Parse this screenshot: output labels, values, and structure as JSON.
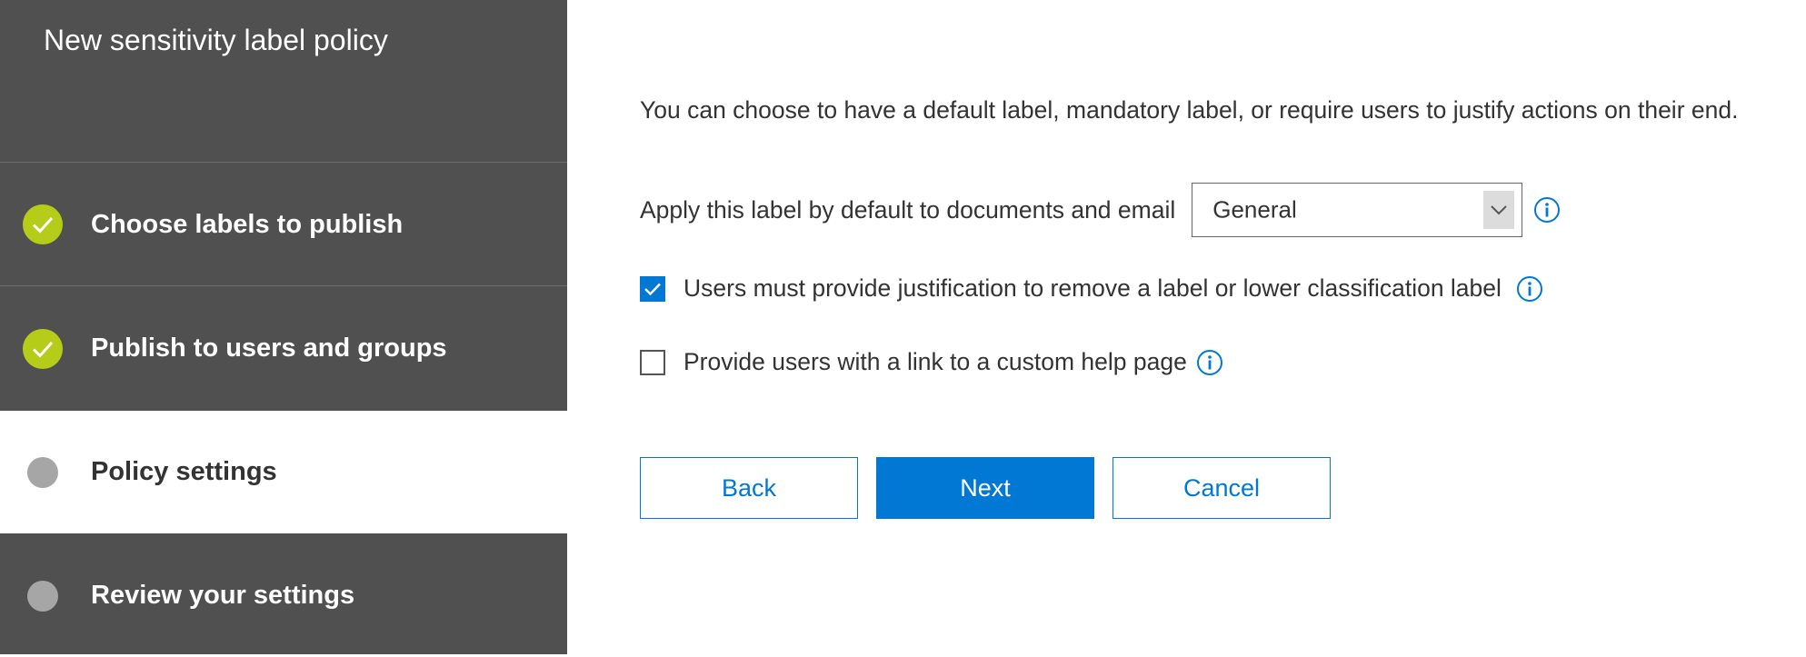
{
  "sidebar": {
    "title": "New sensitivity label policy",
    "steps": [
      {
        "label": "Choose labels to publish",
        "status": "completed"
      },
      {
        "label": "Publish to users and groups",
        "status": "completed"
      },
      {
        "label": "Policy settings",
        "status": "current"
      },
      {
        "label": "Review your settings",
        "status": "pending"
      }
    ]
  },
  "main": {
    "intro": "You can choose to have a default label, mandatory label, or require users to justify actions on their end.",
    "default_label": {
      "label": "Apply this label by default to documents and email",
      "selected": "General"
    },
    "options": [
      {
        "label": "Users must provide justification to remove a label or lower classification label",
        "checked": true
      },
      {
        "label": "Provide users with a link to a custom help page",
        "checked": false
      }
    ],
    "buttons": {
      "back": "Back",
      "next": "Next",
      "cancel": "Cancel"
    }
  },
  "colors": {
    "sidebar_bg": "#505050",
    "accent": "#0078d4",
    "completed": "#b5cc18",
    "pending": "#a6a6a6"
  },
  "icons": [
    "check-circle-icon",
    "pending-circle-icon",
    "chevron-down-icon",
    "info-icon",
    "checkmark-icon"
  ]
}
